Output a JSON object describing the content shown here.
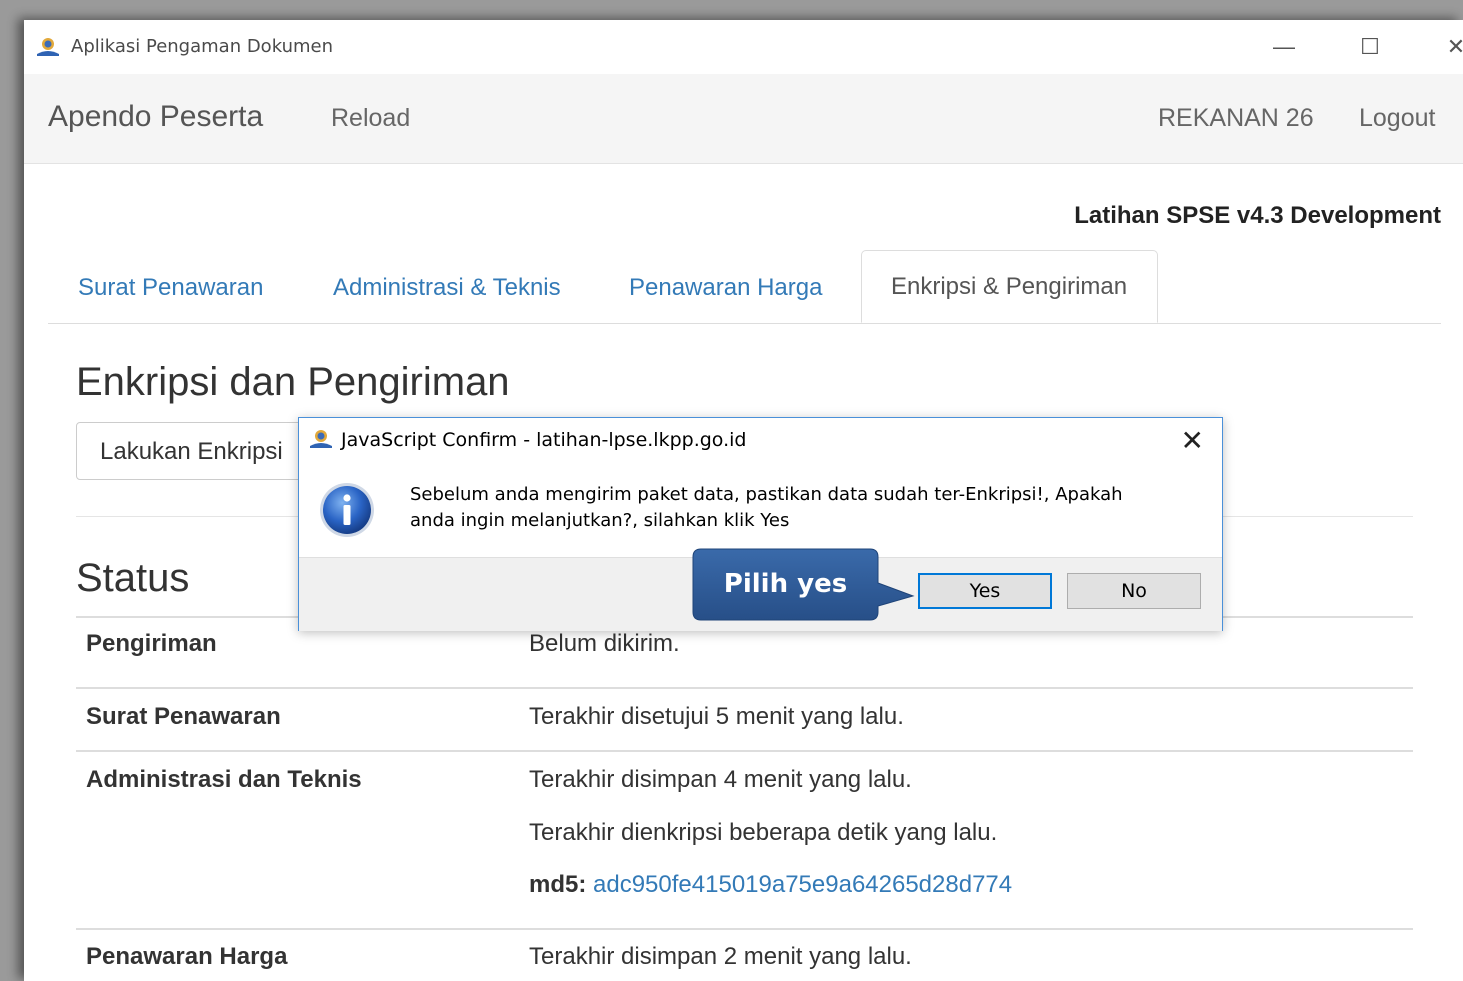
{
  "window": {
    "title": "Aplikasi Pengaman Dokumen"
  },
  "navbar": {
    "brand": "Apendo Peserta",
    "reload": "Reload",
    "user": "REKANAN 26",
    "logout": "Logout"
  },
  "site_title": "Latihan SPSE v4.3 Development",
  "tabs": [
    {
      "label": "Surat Penawaran"
    },
    {
      "label": "Administrasi & Teknis"
    },
    {
      "label": "Penawaran Harga"
    },
    {
      "label": "Enkripsi & Pengiriman"
    }
  ],
  "section_title": "Enkripsi dan Pengiriman",
  "encrypt_button": "Lakukan Enkripsi",
  "status_title": "Status",
  "status_rows": [
    {
      "label": "Pengiriman",
      "values": [
        "Belum dikirim."
      ]
    },
    {
      "label": "Surat Penawaran",
      "values": [
        "Terakhir disetujui 5 menit yang lalu."
      ]
    },
    {
      "label": "Administrasi dan Teknis",
      "values": [
        "Terakhir disimpan 4 menit yang lalu.",
        "Terakhir dienkripsi beberapa detik yang lalu."
      ],
      "md5_label": "md5:",
      "md5_value": "adc950fe415019a75e9a64265d28d774"
    },
    {
      "label": "Penawaran Harga",
      "values": [
        "Terakhir disimpan 2 menit yang lalu."
      ]
    }
  ],
  "dialog": {
    "title": "JavaScript Confirm - latihan-lpse.lkpp.go.id",
    "message_line1": "Sebelum anda mengirim paket data, pastikan data sudah ter-Enkripsi!, Apakah",
    "message_line2": "anda ingin melanjutkan?, silahkan klik Yes",
    "yes": "Yes",
    "no": "No"
  },
  "callout": {
    "text": "Pilih yes"
  },
  "colors": {
    "link": "#337ab7",
    "callout": "#2e5a96",
    "dialog_border": "#4a90d9"
  }
}
